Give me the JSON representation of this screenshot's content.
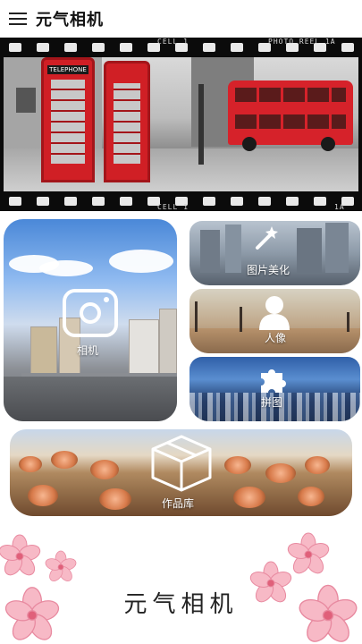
{
  "appbar": {
    "title": "元气相机",
    "menu_icon": "menu-icon"
  },
  "banner": {
    "film_text_top_left": "CELL 1",
    "film_text_top_right": "PHOTO REEL 1A",
    "film_text_bottom_left": "CELL 1",
    "film_text_bottom_right": "1A",
    "booth_sign": "TELEPHONE"
  },
  "tiles": {
    "camera": {
      "label": "相机",
      "icon": "camera-icon"
    },
    "beauty": {
      "label": "图片美化",
      "icon": "magic-wand-icon"
    },
    "people": {
      "label": "人像",
      "icon": "person-icon"
    },
    "puzzle": {
      "label": "拼图",
      "icon": "puzzle-icon"
    },
    "works": {
      "label": "作品库",
      "icon": "box-icon"
    }
  },
  "footer": {
    "title": "元气相机"
  },
  "colors": {
    "accent_red": "#d01f25",
    "text": "#111111"
  }
}
